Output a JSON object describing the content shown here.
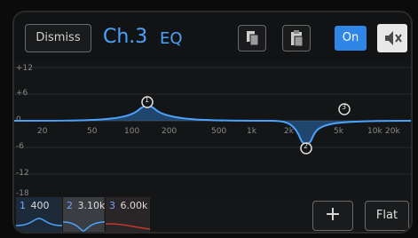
{
  "header": {
    "dismiss_label": "Dismiss",
    "channel_label": "Ch.3",
    "eq_label": "EQ",
    "on_label": "On"
  },
  "graph": {
    "y_labels": [
      "+12",
      "+6",
      "0",
      "-6",
      "-12",
      "-18"
    ],
    "x_labels": [
      "20",
      "50",
      "100",
      "200",
      "500",
      "1k",
      "2k",
      "5k",
      "10k",
      "20k"
    ],
    "markers": [
      "1",
      "2",
      "3"
    ],
    "curve_color": "#4aa3ff"
  },
  "bands": [
    {
      "num": "1",
      "freq": "400"
    },
    {
      "num": "2",
      "freq": "3.10k"
    },
    {
      "num": "3",
      "freq": "6.00k"
    }
  ],
  "footer": {
    "add_label": "+",
    "flat_label": "Flat"
  }
}
